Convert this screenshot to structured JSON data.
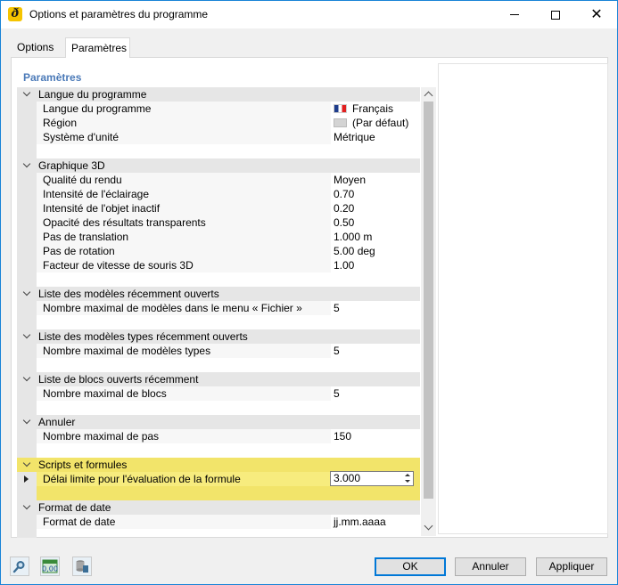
{
  "window": {
    "title": "Options et paramètres du programme"
  },
  "tabs": [
    {
      "label": "Options"
    },
    {
      "label": "Paramètres"
    }
  ],
  "panel": {
    "section_title": "Paramètres"
  },
  "groups": {
    "langue": {
      "label": "Langue du programme",
      "props": [
        {
          "name": "Langue du programme",
          "value": "Français"
        },
        {
          "name": "Région",
          "value": "(Par défaut)"
        },
        {
          "name": "Système d'unité",
          "value": "Métrique"
        }
      ]
    },
    "graphique": {
      "label": "Graphique 3D",
      "props": [
        {
          "name": "Qualité du rendu",
          "value": "Moyen"
        },
        {
          "name": "Intensité de l'éclairage",
          "value": "0.70"
        },
        {
          "name": "Intensité de l'objet inactif",
          "value": "0.20"
        },
        {
          "name": "Opacité des résultats transparents",
          "value": "0.50"
        },
        {
          "name": "Pas de translation",
          "value": "1.000 m"
        },
        {
          "name": "Pas de rotation",
          "value": "5.00 deg"
        },
        {
          "name": "Facteur de vitesse de souris 3D",
          "value": "1.00"
        }
      ]
    },
    "recents": {
      "label": "Liste des modèles récemment ouverts",
      "props": [
        {
          "name": "Nombre maximal de modèles dans le menu « Fichier »",
          "value": "5"
        }
      ]
    },
    "types": {
      "label": "Liste des modèles types récemment ouverts",
      "props": [
        {
          "name": "Nombre maximal de modèles types",
          "value": "5"
        }
      ]
    },
    "blocs": {
      "label": "Liste de blocs ouverts récemment",
      "props": [
        {
          "name": "Nombre maximal de blocs",
          "value": "5"
        }
      ]
    },
    "annuler": {
      "label": "Annuler",
      "props": [
        {
          "name": "Nombre maximal de pas",
          "value": "150"
        }
      ]
    },
    "scripts": {
      "label": "Scripts et formules",
      "props": [
        {
          "name": "Délai limite pour l'évaluation de la formule",
          "value": "3.000"
        }
      ]
    },
    "date": {
      "label": "Format de date",
      "props": [
        {
          "name": "Format de date",
          "value": "jj.mm.aaaa"
        }
      ]
    }
  },
  "buttons": {
    "ok": "OK",
    "cancel": "Annuler",
    "apply": "Appliquer"
  },
  "colors": {
    "highlight": "#f2e46a",
    "accent": "#0078d7",
    "section_title": "#4b7ab8"
  }
}
